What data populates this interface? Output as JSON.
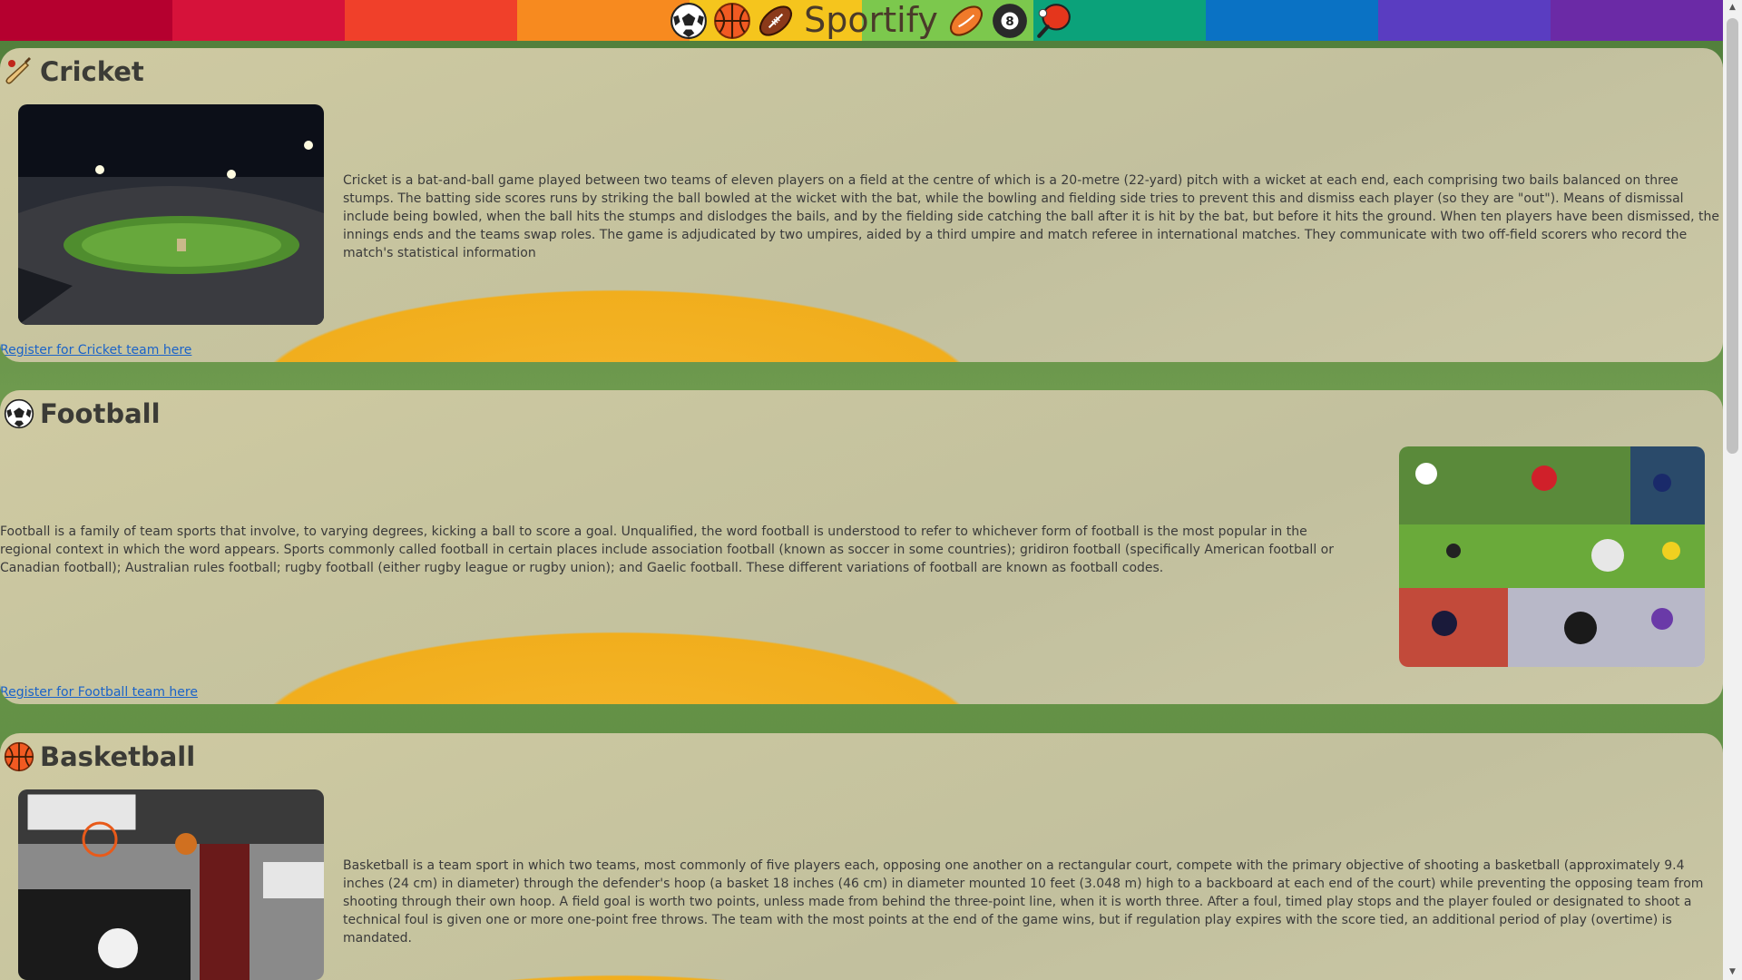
{
  "header": {
    "brand": "Sportify",
    "stripe_colors": [
      "#b5002f",
      "#d6123a",
      "#f0402a",
      "#f78a1f",
      "#f5c51d",
      "#7cc84d",
      "#0ba27a",
      "#0a72c4",
      "#5a3dc1",
      "#6b2aa6"
    ],
    "icons": [
      "soccer-ball-icon",
      "basketball-icon",
      "american-football-icon",
      "rugby-ball-icon",
      "billiard-ball-icon",
      "ping-pong-icon"
    ]
  },
  "sections": {
    "cricket": {
      "title": "Cricket",
      "icon": "cricket-bat-icon",
      "description": "Cricket is a bat-and-ball game played between two teams of eleven players on a field at the centre of which is a 20-metre (22-yard) pitch with a wicket at each end, each comprising two bails balanced on three stumps. The batting side scores runs by striking the ball bowled at the wicket with the bat, while the bowling and fielding side tries to prevent this and dismiss each player (so they are \"out\"). Means of dismissal include being bowled, when the ball hits the stumps and dislodges the bails, and by the fielding side catching the ball after it is hit by the bat, but before it hits the ground. When ten players have been dismissed, the innings ends and the teams swap roles. The game is adjudicated by two umpires, aided by a third umpire and match referee in international matches. They communicate with two off-field scorers who record the match's statistical information",
      "link": "Register for Cricket team here"
    },
    "football": {
      "title": "Football",
      "icon": "soccer-ball-icon",
      "description": "Football is a family of team sports that involve, to varying degrees, kicking a ball to score a goal. Unqualified, the word football is understood to refer to whichever form of football is the most popular in the regional context in which the word appears. Sports commonly called football in certain places include association football (known as soccer in some countries); gridiron football (specifically American football or Canadian football); Australian rules football; rugby football (either rugby league or rugby union); and Gaelic football. These different variations of football are known as football codes.",
      "link": "Register for Football team here"
    },
    "basketball": {
      "title": "Basketball",
      "icon": "basketball-icon",
      "description": "Basketball is a team sport in which two teams, most commonly of five players each, opposing one another on a rectangular court, compete with the primary objective of shooting a basketball (approximately 9.4 inches (24 cm) in diameter) through the defender's hoop (a basket 18 inches (46 cm) in diameter mounted 10 feet (3.048 m) high to a backboard at each end of the court) while preventing the opposing team from shooting through their own hoop. A field goal is worth two points, unless made from behind the three-point line, when it is worth three. After a foul, timed play stops and the player fouled or designated to shoot a technical foul is given one or more one-point free throws. The team with the most points at the end of the game wins, but if regulation play expires with the score tied, an additional period of play (overtime) is mandated."
    }
  }
}
